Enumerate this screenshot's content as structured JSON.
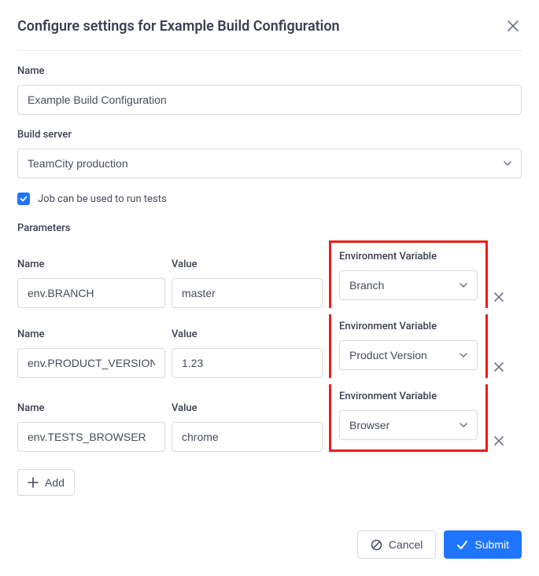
{
  "dialog": {
    "title": "Configure settings for Example Build Configuration"
  },
  "name_field": {
    "label": "Name",
    "value": "Example Build Configuration"
  },
  "build_server_field": {
    "label": "Build server",
    "value": "TeamCity production"
  },
  "job_tests_checkbox": {
    "label": "Job can be used to run tests",
    "checked": true
  },
  "parameters_section": {
    "label": "Parameters",
    "col_name_label": "Name",
    "col_value_label": "Value",
    "col_env_label": "Environment Variable",
    "rows": [
      {
        "name": "env.BRANCH",
        "value": "master",
        "env": "Branch"
      },
      {
        "name": "env.PRODUCT_VERSION",
        "value": "1.23",
        "env": "Product Version"
      },
      {
        "name": "env.TESTS_BROWSER",
        "value": "chrome",
        "env": "Browser"
      }
    ],
    "add_label": "Add"
  },
  "footer": {
    "cancel_label": "Cancel",
    "submit_label": "Submit"
  }
}
